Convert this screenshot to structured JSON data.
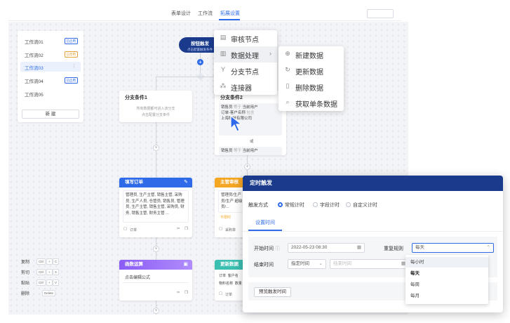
{
  "tabs": [
    {
      "label": "表单设计"
    },
    {
      "label": "工作流"
    },
    {
      "label": "拓展设置"
    }
  ],
  "workflows": {
    "items": [
      {
        "name": "工作流01",
        "badge": "已启用",
        "badge_color": "#2f6be8"
      },
      {
        "name": "工作流02",
        "badge": "已停用",
        "badge_color": "#e6a23c"
      },
      {
        "name": "工作流03",
        "badge": "",
        "badge_color": ""
      },
      {
        "name": "工作流04",
        "badge": "已启用",
        "badge_color": "#2f6be8"
      },
      {
        "name": "工作流05",
        "badge": "",
        "badge_color": ""
      }
    ],
    "new_label": "新 建"
  },
  "start_node": {
    "title": "按钮触发",
    "subtitle": "点击配置触发条件"
  },
  "context_menu": {
    "items": [
      {
        "icon": "audit-node-icon",
        "label": "审核节点"
      },
      {
        "icon": "data-process-icon",
        "label": "数据处理"
      },
      {
        "icon": "branch-node-icon",
        "label": "分支节点"
      },
      {
        "icon": "connector-icon",
        "label": "连接器"
      }
    ],
    "submenu": [
      {
        "icon": "plus-circle-icon",
        "label": "新建数据"
      },
      {
        "icon": "refresh-icon",
        "label": "更新数据"
      },
      {
        "icon": "trash-icon",
        "label": "删除数据"
      },
      {
        "icon": "search-icon",
        "label": "获取单条数据"
      }
    ]
  },
  "branch1": {
    "title": "分支条件1",
    "desc1": "所有数据都可进入该分支",
    "desc2": "点击配置分支条件"
  },
  "branch2": {
    "title": "分支条件2",
    "row1_field": "销售员",
    "row1_op": "等于",
    "row1_val": "当前用户",
    "row2_field": "订单-客户名称",
    "row2_op": "包含",
    "row2_val": "上海",
    "row2_cont": "科技有限公司",
    "or_label": "或",
    "row3_field": "销售员",
    "row3_op": "等于",
    "row3_val": "当前用户"
  },
  "fill_order": {
    "title": "填写订单",
    "body": "管理员, 生产主管, 销售主管, 采购员, 生产人员, 仓管员, 销售员, 管理员, 生产主管, 销售主管, 采购员, 财务, 销售主管, 财务主管 ...",
    "footer": "订单",
    "color": "#2f6be8"
  },
  "supervisor_review": {
    "title": "主管审核",
    "body": "管理员/生产 采购员/生产 超级管理员/...",
    "status": "不限时",
    "footer": "采购单",
    "color": "#f5a623"
  },
  "func_calc": {
    "title": "函数运算",
    "body": "点击编辑公式",
    "color": "#8a5cf6"
  },
  "update_data": {
    "title": "更新数据",
    "col1": "订单",
    "col2": "客户名",
    "row1": "物料名称",
    "row2": "数量",
    "footer": "订单",
    "color": "#3bbfb0"
  },
  "shortcuts": [
    {
      "label": "复制",
      "keys": [
        "Ctrl",
        "+",
        "C"
      ]
    },
    {
      "label": "剪切",
      "keys": [
        "Ctrl",
        "+",
        "X"
      ]
    },
    {
      "label": "黏贴",
      "keys": [
        "Ctrl",
        "+",
        "V"
      ]
    },
    {
      "label": "删除",
      "keys": [
        "Delete"
      ]
    }
  ],
  "modal": {
    "title": "定时触发",
    "mode_label": "触发方式",
    "modes": [
      "常规计时",
      "字段计时",
      "自定义计时"
    ],
    "subtab": "设置时间",
    "start_label": "开始时间",
    "start_value": "2022-05-23 08:30",
    "end_label": "结束时间",
    "end_mode": "指定时间",
    "end_placeholder": "结束时间",
    "repeat_label": "重复规则",
    "repeat_value": "每天",
    "preview_label": "预览触发时间",
    "options": [
      "每小时",
      "每天",
      "每周",
      "每月"
    ]
  }
}
